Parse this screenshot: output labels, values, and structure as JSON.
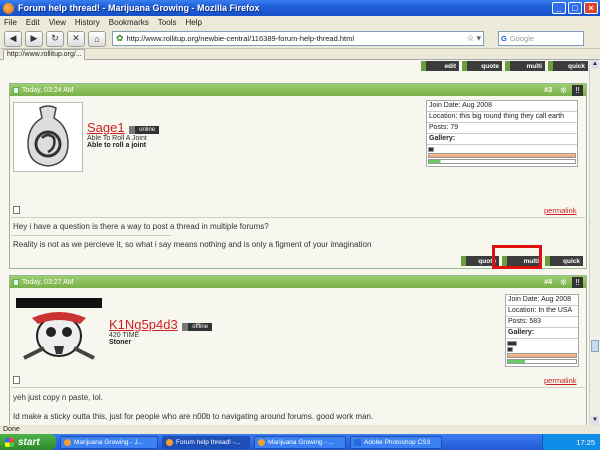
{
  "window": {
    "title": "Forum help thread! - Marijuana Growing - Mozilla Firefox"
  },
  "menu": [
    "File",
    "Edit",
    "View",
    "History",
    "Bookmarks",
    "Tools",
    "Help"
  ],
  "nav": {
    "url": "http://www.rollitup.org/newbie-central/116389-forum-help-thread.html",
    "search_placeholder": "Google"
  },
  "tab": {
    "label": "http://www.rollitup.org/..."
  },
  "top_buttons": [
    "edit",
    "quote",
    "multi",
    "quick"
  ],
  "posts": [
    {
      "date": "Today, 03:24 AM",
      "number": "#3",
      "username": "Sage1",
      "status": "online",
      "usertitle": "Able To Roll A Joint",
      "rank": "Able to roll a joint",
      "info": {
        "join_date": "Join Date: Aug 2008",
        "location": "Location: this big round thing they call earth",
        "posts": "Posts: 79",
        "gallery": "Gallery:"
      },
      "bars": [
        0.03,
        0.85,
        0.08
      ],
      "permalink": "permalink",
      "message": "Hey i have a question is there a way to post a thread in multiple forums?",
      "signature": "Reality is not as we percieve it, so what i say means nothing and is only a figment of your imagination",
      "buttons": [
        "quote",
        "multi",
        "quick"
      ]
    },
    {
      "date": "Today, 03:27 AM",
      "number": "#4",
      "username": "K1Ng5p4d3",
      "status": "offline",
      "usertitle": "420 TIME",
      "rank": "Stoner",
      "info": {
        "join_date": "Join Date: Aug 2008",
        "location": "Location: In the USA",
        "posts": "Posts: 583",
        "gallery": "Gallery:"
      },
      "bars": [
        0.08,
        0.05,
        0.9,
        0.12
      ],
      "permalink": "permalink",
      "message": "yeh just copy n paste, lol.",
      "message2": "Id make a sticky outta this, just for people who are n00b to navigating around forums. good work man."
    }
  ],
  "statusbar": {
    "text": "Done"
  },
  "taskbar": {
    "start": "start",
    "items": [
      "Marijuana Growing - J...",
      "Forum help thread! -...",
      "Marijuana Growing - ...",
      "Adobe Photoshop CS3"
    ],
    "clock": "17:25"
  },
  "colors": {
    "accent_red": "#cc2222",
    "header_green": "#7ab048",
    "highlight_box": "#e01010"
  }
}
